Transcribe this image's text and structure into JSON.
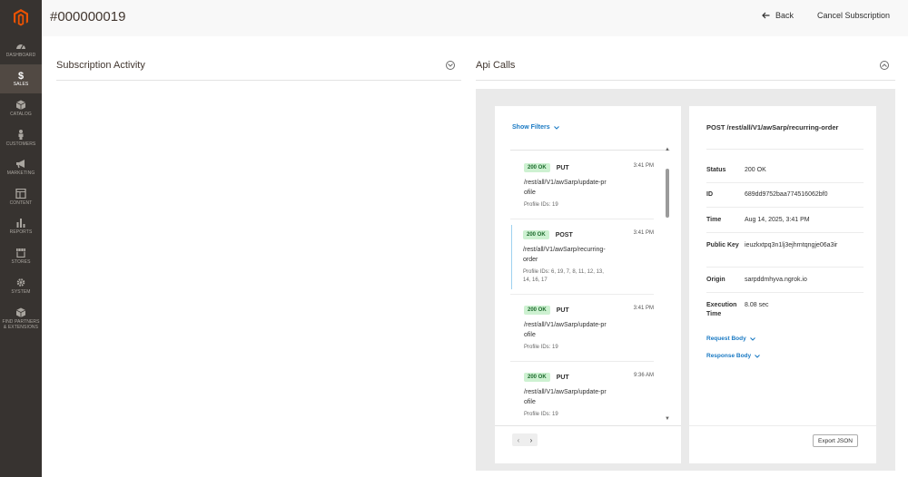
{
  "page": {
    "title": "#000000019",
    "back_label": "Back",
    "cancel_label": "Cancel Subscription"
  },
  "sidebar": {
    "items": [
      {
        "label": "DASHBOARD",
        "icon": "dashboard-icon"
      },
      {
        "label": "SALES",
        "icon": "dollar-icon",
        "active": true
      },
      {
        "label": "CATALOG",
        "icon": "box-icon"
      },
      {
        "label": "CUSTOMERS",
        "icon": "person-icon"
      },
      {
        "label": "MARKETING",
        "icon": "megaphone-icon"
      },
      {
        "label": "CONTENT",
        "icon": "layout-icon"
      },
      {
        "label": "REPORTS",
        "icon": "bar-chart-icon"
      },
      {
        "label": "STORES",
        "icon": "store-icon"
      },
      {
        "label": "SYSTEM",
        "icon": "gear-icon"
      },
      {
        "label": "FIND PARTNERS & EXTENSIONS",
        "icon": "cube-icon"
      }
    ]
  },
  "sections": {
    "activity_title": "Subscription Activity",
    "api_title": "Api Calls"
  },
  "api_list": {
    "show_filters": "Show Filters",
    "items": [
      {
        "status": "200 OK",
        "method": "PUT",
        "time": "3:41 PM",
        "endpoint": "/rest/all/V1/awSarp/update-profile",
        "profiles": "Profile IDs: 19"
      },
      {
        "status": "200 OK",
        "method": "POST",
        "time": "3:41 PM",
        "endpoint": "/rest/all/V1/awSarp/recurring-order",
        "profiles": "Profile IDs: 6, 19, 7, 8, 11, 12, 13, 14, 16, 17"
      },
      {
        "status": "200 OK",
        "method": "PUT",
        "time": "3:41 PM",
        "endpoint": "/rest/all/V1/awSarp/update-profile",
        "profiles": "Profile IDs: 19"
      },
      {
        "status": "200 OK",
        "method": "PUT",
        "time": "9:36 AM",
        "endpoint": "/rest/all/V1/awSarp/update-profile",
        "profiles": "Profile IDs: 19"
      }
    ],
    "pager": {
      "prev": "‹",
      "next": "›"
    }
  },
  "detail": {
    "title": "POST /rest/all/V1/awSarp/recurring-order",
    "status_label": "Status",
    "status_value": "200 OK",
    "id_label": "ID",
    "id_value": "689dd9752baa774516062bf0",
    "time_label": "Time",
    "time_value": "Aug 14, 2025, 3:41 PM",
    "key_label": "Public Key",
    "key_value": "ieuzkxtpq3n1lj3ejhrntqngje06a3ir",
    "origin_label": "Origin",
    "origin_value": "sarpddmhyva.ngrok.io",
    "exec_label": "Execution Time",
    "exec_value": "8.08 sec",
    "request_body": "Request Body",
    "response_body": "Response Body",
    "export_label": "Export JSON"
  },
  "colors": {
    "sidebar": "#373330",
    "accent": "#eb5202",
    "link": "#1979c3",
    "badge_bg": "#cdf1d1"
  }
}
